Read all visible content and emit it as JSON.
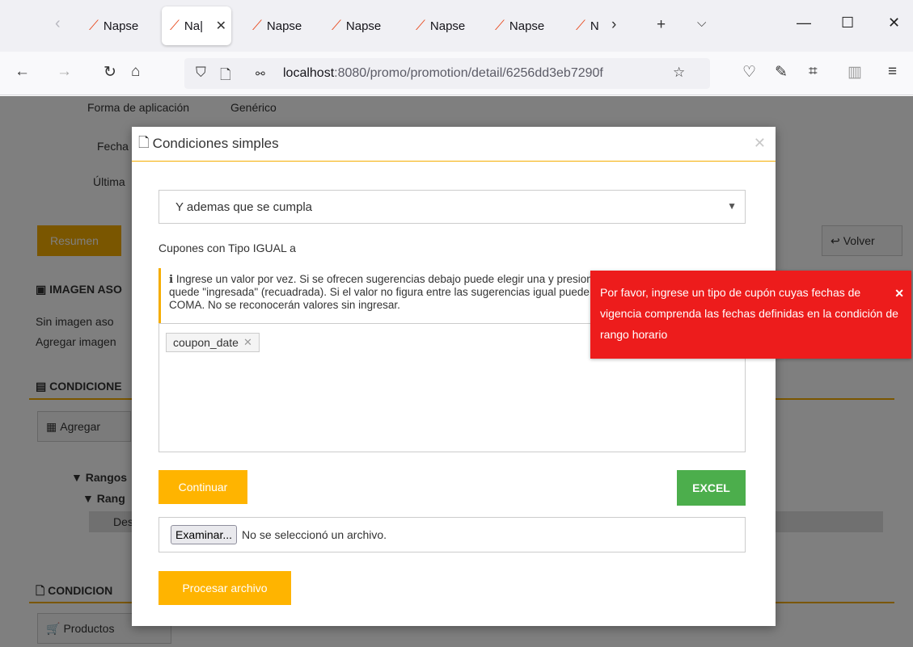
{
  "browser": {
    "tabs": [
      {
        "label": "Napse"
      },
      {
        "label": "Na|"
      },
      {
        "label": "Napse"
      },
      {
        "label": "Napse"
      },
      {
        "label": "Napse"
      },
      {
        "label": "Napse"
      },
      {
        "label": "N"
      }
    ],
    "url_host": "localhost",
    "url_path": ":8080/promo/promotion/detail/6256dd3eb7290f"
  },
  "background": {
    "forma_label": "Forma de aplicación",
    "forma_value": "Genérico",
    "fecha_label": "Fecha",
    "ultima_label": "Última",
    "resumen_button": "Resumen",
    "volver_button": "Volver",
    "imagen_title": "IMAGEN ASO",
    "sin_imagen": "Sin imagen aso",
    "agregar_imagen": "Agregar imagen",
    "condiciones_title": "CONDICIONE",
    "agregar_button": "Agregar",
    "rangos": "▼ Rangos",
    "rang": "▼ Rang",
    "des": "Des",
    "condiciones2_title": "CONDICION",
    "productos": "Productos"
  },
  "modal": {
    "title": "Condiciones simples",
    "select_value": "Y ademas que se cumpla",
    "field_label": "Cupones con Tipo IGUAL a",
    "hint_text": "Ingrese un valor por vez. Si se ofrecen sugerencias debajo puede elegir una y presionar ENTER o TAB para que quede \"ingresada\" (recuadrada). Si el valor no figura entre las sugerencias igual puede ingresarlo presionando COMA. No se reconocerán valores sin ingresar.",
    "tag": "coupon_date",
    "continuar_button": "Continuar",
    "excel_button": "EXCEL",
    "file_button": "Examinar...",
    "file_status": "No se seleccionó un archivo.",
    "procesar_button": "Procesar archivo"
  },
  "toast": {
    "message": "Por favor, ingrese un tipo de cupón cuyas fechas de vigencia comprenda las fechas definidas en la condición de rango horario"
  },
  "colors": {
    "accent": "#ffb400",
    "excel": "#4cae4c",
    "error": "#ed1c1c"
  }
}
